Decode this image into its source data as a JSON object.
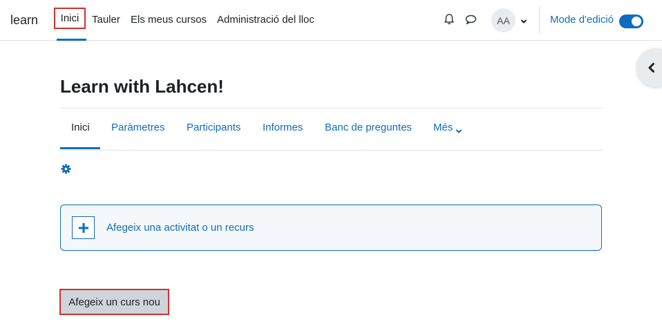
{
  "navbar": {
    "brand": "learn",
    "items": [
      {
        "label": "Inici"
      },
      {
        "label": "Tauler"
      },
      {
        "label": "Els meus cursos"
      },
      {
        "label": "Administració del lloc"
      }
    ],
    "avatar_initials": "AA",
    "edit_mode_label": "Mode d'edició",
    "edit_mode_on": true
  },
  "icons": {
    "notifications": "bell-icon",
    "messages": "chat-bubble-icon",
    "user_menu": "chevron-down-icon",
    "drawer": "chevron-left-icon",
    "settings": "gear-icon",
    "add_activity": "plus-icon"
  },
  "page": {
    "title": "Learn with Lahcen!"
  },
  "secondary_nav": {
    "tabs": [
      {
        "label": "Inici"
      },
      {
        "label": "Paràmetres"
      },
      {
        "label": "Participants"
      },
      {
        "label": "Informes"
      },
      {
        "label": "Banc de preguntes"
      },
      {
        "label": "Més"
      }
    ]
  },
  "main": {
    "add_activity_label": "Afegeix una activitat o un recurs",
    "add_course_label": "Afegeix un curs nou"
  },
  "colors": {
    "primary": "#0f6cbf",
    "highlight": "#d32f2f",
    "text": "#1d2125"
  }
}
